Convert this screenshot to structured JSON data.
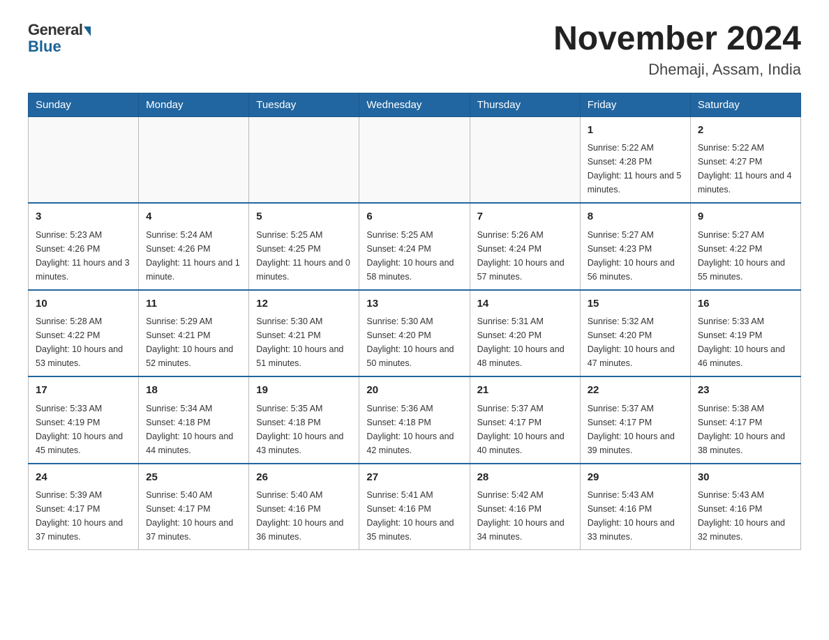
{
  "header": {
    "logo_general": "General",
    "logo_blue": "Blue",
    "month_year": "November 2024",
    "location": "Dhemaji, Assam, India"
  },
  "weekdays": [
    "Sunday",
    "Monday",
    "Tuesday",
    "Wednesday",
    "Thursday",
    "Friday",
    "Saturday"
  ],
  "weeks": [
    [
      {
        "day": "",
        "info": ""
      },
      {
        "day": "",
        "info": ""
      },
      {
        "day": "",
        "info": ""
      },
      {
        "day": "",
        "info": ""
      },
      {
        "day": "",
        "info": ""
      },
      {
        "day": "1",
        "info": "Sunrise: 5:22 AM\nSunset: 4:28 PM\nDaylight: 11 hours and 5 minutes."
      },
      {
        "day": "2",
        "info": "Sunrise: 5:22 AM\nSunset: 4:27 PM\nDaylight: 11 hours and 4 minutes."
      }
    ],
    [
      {
        "day": "3",
        "info": "Sunrise: 5:23 AM\nSunset: 4:26 PM\nDaylight: 11 hours and 3 minutes."
      },
      {
        "day": "4",
        "info": "Sunrise: 5:24 AM\nSunset: 4:26 PM\nDaylight: 11 hours and 1 minute."
      },
      {
        "day": "5",
        "info": "Sunrise: 5:25 AM\nSunset: 4:25 PM\nDaylight: 11 hours and 0 minutes."
      },
      {
        "day": "6",
        "info": "Sunrise: 5:25 AM\nSunset: 4:24 PM\nDaylight: 10 hours and 58 minutes."
      },
      {
        "day": "7",
        "info": "Sunrise: 5:26 AM\nSunset: 4:24 PM\nDaylight: 10 hours and 57 minutes."
      },
      {
        "day": "8",
        "info": "Sunrise: 5:27 AM\nSunset: 4:23 PM\nDaylight: 10 hours and 56 minutes."
      },
      {
        "day": "9",
        "info": "Sunrise: 5:27 AM\nSunset: 4:22 PM\nDaylight: 10 hours and 55 minutes."
      }
    ],
    [
      {
        "day": "10",
        "info": "Sunrise: 5:28 AM\nSunset: 4:22 PM\nDaylight: 10 hours and 53 minutes."
      },
      {
        "day": "11",
        "info": "Sunrise: 5:29 AM\nSunset: 4:21 PM\nDaylight: 10 hours and 52 minutes."
      },
      {
        "day": "12",
        "info": "Sunrise: 5:30 AM\nSunset: 4:21 PM\nDaylight: 10 hours and 51 minutes."
      },
      {
        "day": "13",
        "info": "Sunrise: 5:30 AM\nSunset: 4:20 PM\nDaylight: 10 hours and 50 minutes."
      },
      {
        "day": "14",
        "info": "Sunrise: 5:31 AM\nSunset: 4:20 PM\nDaylight: 10 hours and 48 minutes."
      },
      {
        "day": "15",
        "info": "Sunrise: 5:32 AM\nSunset: 4:20 PM\nDaylight: 10 hours and 47 minutes."
      },
      {
        "day": "16",
        "info": "Sunrise: 5:33 AM\nSunset: 4:19 PM\nDaylight: 10 hours and 46 minutes."
      }
    ],
    [
      {
        "day": "17",
        "info": "Sunrise: 5:33 AM\nSunset: 4:19 PM\nDaylight: 10 hours and 45 minutes."
      },
      {
        "day": "18",
        "info": "Sunrise: 5:34 AM\nSunset: 4:18 PM\nDaylight: 10 hours and 44 minutes."
      },
      {
        "day": "19",
        "info": "Sunrise: 5:35 AM\nSunset: 4:18 PM\nDaylight: 10 hours and 43 minutes."
      },
      {
        "day": "20",
        "info": "Sunrise: 5:36 AM\nSunset: 4:18 PM\nDaylight: 10 hours and 42 minutes."
      },
      {
        "day": "21",
        "info": "Sunrise: 5:37 AM\nSunset: 4:17 PM\nDaylight: 10 hours and 40 minutes."
      },
      {
        "day": "22",
        "info": "Sunrise: 5:37 AM\nSunset: 4:17 PM\nDaylight: 10 hours and 39 minutes."
      },
      {
        "day": "23",
        "info": "Sunrise: 5:38 AM\nSunset: 4:17 PM\nDaylight: 10 hours and 38 minutes."
      }
    ],
    [
      {
        "day": "24",
        "info": "Sunrise: 5:39 AM\nSunset: 4:17 PM\nDaylight: 10 hours and 37 minutes."
      },
      {
        "day": "25",
        "info": "Sunrise: 5:40 AM\nSunset: 4:17 PM\nDaylight: 10 hours and 37 minutes."
      },
      {
        "day": "26",
        "info": "Sunrise: 5:40 AM\nSunset: 4:16 PM\nDaylight: 10 hours and 36 minutes."
      },
      {
        "day": "27",
        "info": "Sunrise: 5:41 AM\nSunset: 4:16 PM\nDaylight: 10 hours and 35 minutes."
      },
      {
        "day": "28",
        "info": "Sunrise: 5:42 AM\nSunset: 4:16 PM\nDaylight: 10 hours and 34 minutes."
      },
      {
        "day": "29",
        "info": "Sunrise: 5:43 AM\nSunset: 4:16 PM\nDaylight: 10 hours and 33 minutes."
      },
      {
        "day": "30",
        "info": "Sunrise: 5:43 AM\nSunset: 4:16 PM\nDaylight: 10 hours and 32 minutes."
      }
    ]
  ]
}
